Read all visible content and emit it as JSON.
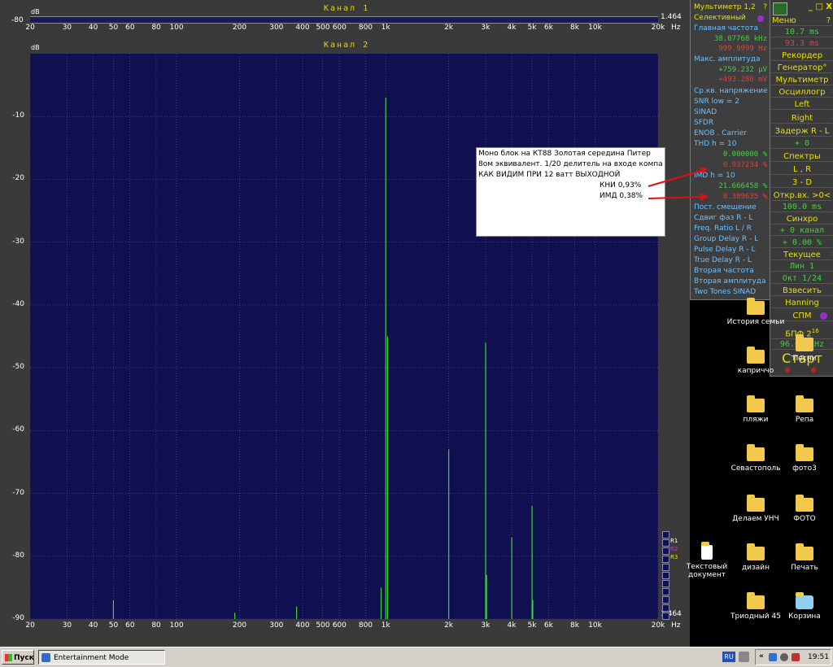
{
  "channel1": {
    "title": "Канал 1",
    "db_unit": "dB",
    "level_value": "1.464",
    "left_mark": "-80"
  },
  "channel2": {
    "title": "Канал 2",
    "db_unit": "dB",
    "level_value": "1.464"
  },
  "x_ticks": [
    "20",
    "30",
    "40",
    "50",
    "60",
    "80",
    "100",
    "200",
    "300",
    "400",
    "500",
    "600",
    "800",
    "1k",
    "2k",
    "3k",
    "4k",
    "5k",
    "6k",
    "8k",
    "10k",
    "20k"
  ],
  "x_unit": "Hz",
  "y_ticks": [
    "-10",
    "-20",
    "-30",
    "-40",
    "-50",
    "-60",
    "-70",
    "-80",
    "-90"
  ],
  "legend_labels": [
    "R1",
    "R2",
    "R3"
  ],
  "chart_data": {
    "type": "line",
    "title": "Канал 2",
    "xlabel": "Hz",
    "ylabel": "dB",
    "x_scale": "log",
    "xlim": [
      20,
      20000
    ],
    "ylim": [
      -90,
      0
    ],
    "grid": true,
    "series": [
      {
        "peaks": [
          {
            "x": 50,
            "y": -87
          },
          {
            "x": 190,
            "y": -89
          },
          {
            "x": 375,
            "y": -88
          },
          {
            "x": 950,
            "y": -85
          },
          {
            "x": 1000,
            "y": -7
          },
          {
            "x": 1020,
            "y": -45
          },
          {
            "x": 2000,
            "y": -63
          },
          {
            "x": 3000,
            "y": -46
          },
          {
            "x": 3030,
            "y": -83
          },
          {
            "x": 4000,
            "y": -77
          },
          {
            "x": 5000,
            "y": -72
          },
          {
            "x": 5040,
            "y": -87
          }
        ]
      }
    ]
  },
  "multimeter": {
    "title": "Мультиметр 1,2",
    "help": "?",
    "mode": "Селективный",
    "main_freq_label": "Главная частота",
    "main_freq_1": "38.07768 kHz",
    "main_freq_2": "999.9999 Hz",
    "max_amp_label": "Макс. амплитуда",
    "max_amp_1": "+759.232 µV",
    "max_amp_2": "+493.280 mV",
    "rms_label": "Ср.кв. напряжение",
    "snr_label": "SNR   low =  2",
    "sinad_label": "SINAD",
    "sfdr_label": "SFDR",
    "enob_label": "ENOB . Carrier",
    "thd_label": "THD     h =  10",
    "thd_val_1": "0.000000 %",
    "thd_val_2": "0.937234 %",
    "imd_label": "IMD     h =  10",
    "imd_val_1": "21.666458 %",
    "imd_val_2": "0.389635 %",
    "dc_label": "Пост. смещение",
    "phase_label": "Сдвиг фаз R - L",
    "ratio_label": "Freq. Ratio  L / R",
    "group_label": "Group Delay R - L",
    "pulse_label": "Pulse Delay R - L",
    "true_label": "True Delay R - L",
    "second_freq_label": "Вторая частота",
    "second_amp_label": "Вторая амплитуда",
    "two_tones_label": "Two Tones SINAD"
  },
  "controls": {
    "win_buttons": "_ □ X",
    "menu": "Меню",
    "help": "?",
    "time_1": "10.7 ms",
    "time_2": "93.3 ms",
    "recorder": "Рекордер",
    "generator": "Генератор°",
    "multimeter": "Мультиметр",
    "oscilloscope": "Осциллогр",
    "left": "Left",
    "right": "Right",
    "delay": "Задерж R - L",
    "delay_val": "+      0",
    "spectra": "Спектры",
    "lr": "L , R",
    "three_d": "3 - D",
    "open_input": "Откр.вх. >0<",
    "open_val": "100.0 ms",
    "sync": "Синхро",
    "sync_val": "+  0 канал",
    "sync_pct": "+  0.00 %",
    "current": "Текущее",
    "lin": "Лин      1",
    "oct": "Окт   1/24",
    "weigh": "Взвесить",
    "hanning": "Hanning",
    "spm": "СПМ",
    "bpf": "БПФ   2",
    "bpf_pow": "16",
    "bpf_freq": "96.00 kHz",
    "start": "Старт"
  },
  "annotation": {
    "line1": "Моно блок на КТ88  Золотая   середина Питер",
    "line2": "8ом эквивалент. 1/20 делитель на входе компа",
    "line3": "КАК  ВИДИМ ПРИ 12 ватт ВЫХОДНОЙ",
    "line4": "КНИ  0,93%",
    "line5": "ИМД 0,38%"
  },
  "desktop": {
    "icons": [
      "История семьи",
      "Песни",
      "каприччо",
      "пляжи",
      "Репа",
      "Севастополь",
      "фото3",
      "Делаем УНЧ",
      "ФОТО",
      "Текстовый документ",
      "дизайн",
      "Печать",
      "Триодный 45",
      "Корзина"
    ]
  },
  "taskbar": {
    "start": "Пуск",
    "task": "Entertainment Mode",
    "lang": "RU",
    "clock": "19:51"
  },
  "colors": {
    "plot_bg": "#101050",
    "trace": "#3fd23f",
    "label_blue": "#6cc0ff",
    "label_yellow": "#e8e000"
  }
}
